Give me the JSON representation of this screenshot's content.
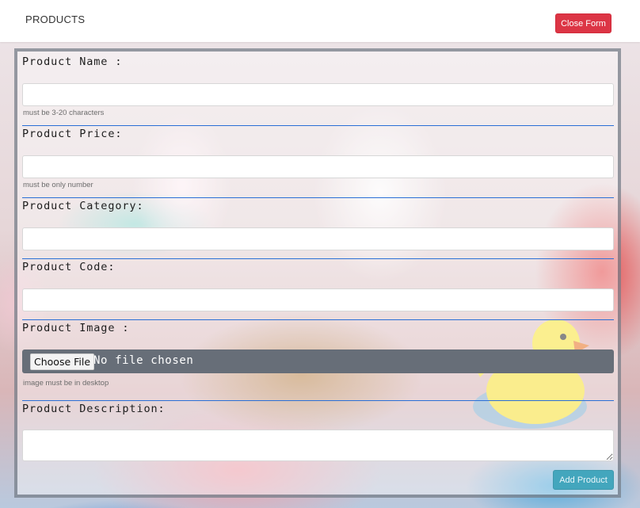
{
  "header": {
    "brand": "PRODUCTS",
    "close_form_label": "Close Form"
  },
  "form": {
    "product_name": {
      "label": "Product Name :",
      "value": "",
      "hint": "must be 3-20 characters"
    },
    "product_price": {
      "label": "Product Price:",
      "value": "",
      "hint": "must be only number"
    },
    "product_category": {
      "label": "Product Category:",
      "value": ""
    },
    "product_code": {
      "label": "Product Code:",
      "value": ""
    },
    "product_image": {
      "label": "Product Image :",
      "button_label": "Choose File",
      "status": "No file chosen",
      "hint": "image must be in desktop"
    },
    "product_description": {
      "label": "Product Description:",
      "value": ""
    },
    "submit_label": "Add Product"
  },
  "colors": {
    "danger": "#dc3545",
    "info": "#43a6bd",
    "divider": "#2a6fd6",
    "file_field": "#676e78"
  }
}
